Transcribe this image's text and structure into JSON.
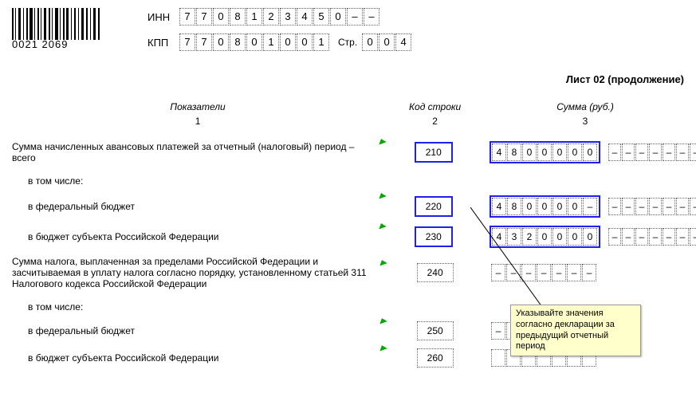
{
  "barcode_text": "0021 2069",
  "inn_label": "ИНН",
  "inn_cells": [
    "7",
    "7",
    "0",
    "8",
    "1",
    "2",
    "3",
    "4",
    "5",
    "0",
    "–",
    "–"
  ],
  "kpp_label": "КПП",
  "kpp_cells": [
    "7",
    "7",
    "0",
    "8",
    "0",
    "1",
    "0",
    "0",
    "1"
  ],
  "page_label": "Стр.",
  "page_cells": [
    "0",
    "0",
    "4"
  ],
  "sheet_title": "Лист 02 (продолжение)",
  "headers": {
    "c1": "Показатели",
    "c2": "Код строки",
    "c3": "Сумма (руб.)"
  },
  "headers2": {
    "c1": "1",
    "c2": "2",
    "c3": "3"
  },
  "rows": {
    "r210": {
      "desc": "Сумма начисленных авансовых платежей за отчетный (налоговый) период – всего",
      "code": "210",
      "sum": [
        "4",
        "8",
        "0",
        "0",
        "0",
        "0",
        "0"
      ]
    },
    "including": "в том числе:",
    "r220": {
      "desc": "в федеральный бюджет",
      "code": "220",
      "sum": [
        "4",
        "8",
        "0",
        "0",
        "0",
        "0",
        "–"
      ]
    },
    "r230": {
      "desc": "в бюджет субъекта Российской Федерации",
      "code": "230",
      "sum": [
        "4",
        "3",
        "2",
        "0",
        "0",
        "0",
        "0"
      ]
    },
    "r240": {
      "desc": "Сумма налога, выплаченная за пределами Российской Федерации и засчитываемая в уплату налога согласно порядку, установленному статьей 311 Налогового кодекса Российской Федерации",
      "code": "240",
      "sum": [
        "–",
        "–",
        "–",
        "–",
        "–",
        "–",
        "–"
      ]
    },
    "r250": {
      "desc": "в федеральный бюджет",
      "code": "250",
      "sum": [
        "–",
        "–",
        "–",
        "–",
        "–",
        "–",
        "–"
      ]
    },
    "r260": {
      "desc": "в бюджет субъекта Российской Федерации",
      "code": "260",
      "sum": [
        "",
        "",
        "",
        "",
        "",
        "",
        ""
      ]
    }
  },
  "dash_block": [
    "–",
    "–",
    "–",
    "–",
    "–",
    "–",
    "–",
    "–"
  ],
  "tooltip": "Указывайте значения согласно декларации за предыдущий отчетный период"
}
